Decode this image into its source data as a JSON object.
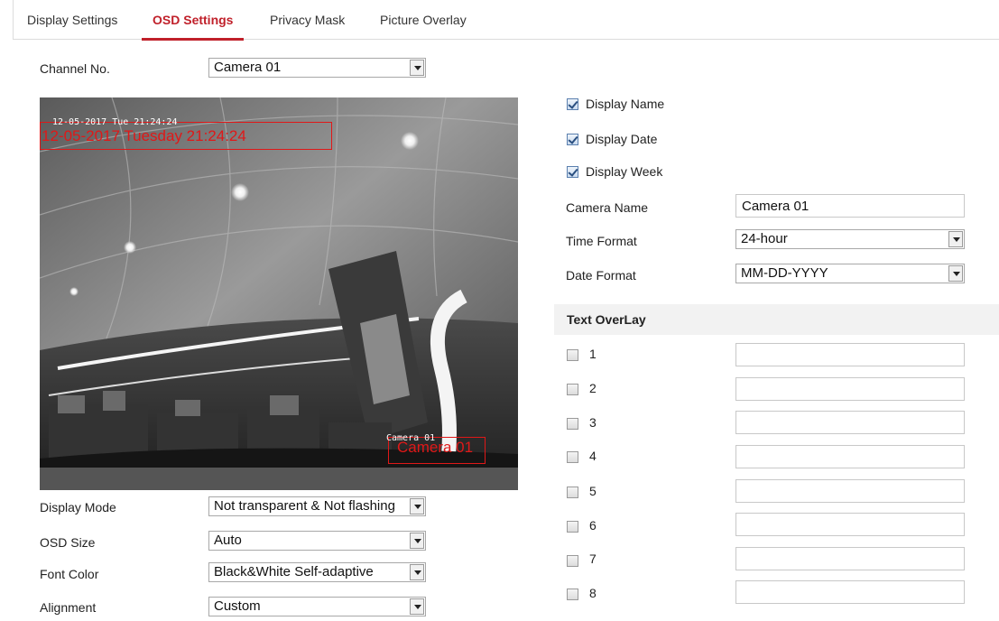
{
  "tabs": [
    {
      "label": "Display Settings",
      "active": false
    },
    {
      "label": "OSD Settings",
      "active": true
    },
    {
      "label": "Privacy Mask",
      "active": false
    },
    {
      "label": "Picture Overlay",
      "active": false
    }
  ],
  "channel": {
    "label": "Channel No.",
    "value": "Camera 01"
  },
  "preview": {
    "osd_date_small": "12-05-2017 Tue 21:24:24",
    "osd_date_large": "12-05-2017 Tuesday 21:24:24",
    "osd_name_small": "Camera 01",
    "osd_name_large": "Camera 01"
  },
  "left_fields": {
    "display_mode": {
      "label": "Display Mode",
      "value": "Not transparent & Not flashing"
    },
    "osd_size": {
      "label": "OSD Size",
      "value": "Auto"
    },
    "font_color": {
      "label": "Font Color",
      "value": "Black&White Self-adaptive"
    },
    "alignment": {
      "label": "Alignment",
      "value": "Custom"
    }
  },
  "checks": {
    "display_name": {
      "label": "Display Name",
      "checked": true
    },
    "display_date": {
      "label": "Display Date",
      "checked": true
    },
    "display_week": {
      "label": "Display Week",
      "checked": true
    }
  },
  "right_fields": {
    "camera_name": {
      "label": "Camera Name",
      "value": "Camera 01"
    },
    "time_format": {
      "label": "Time Format",
      "value": "24-hour"
    },
    "date_format": {
      "label": "Date Format",
      "value": "MM-DD-YYYY"
    }
  },
  "text_overlay": {
    "title": "Text OverLay",
    "rows": [
      {
        "num": "1",
        "value": ""
      },
      {
        "num": "2",
        "value": ""
      },
      {
        "num": "3",
        "value": ""
      },
      {
        "num": "4",
        "value": ""
      },
      {
        "num": "5",
        "value": ""
      },
      {
        "num": "6",
        "value": ""
      },
      {
        "num": "7",
        "value": ""
      },
      {
        "num": "8",
        "value": ""
      }
    ]
  },
  "colors": {
    "accent": "#c0202a",
    "osd_red": "#e01818"
  }
}
